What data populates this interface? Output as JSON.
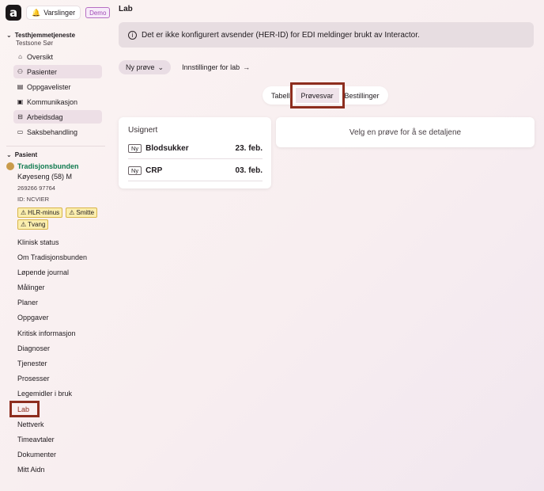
{
  "app": {
    "logo": "a",
    "notifications_label": "Varslinger",
    "demo_badge": "Demo"
  },
  "unit": {
    "name": "Testhjemmetjeneste",
    "zone": "Testsone Sør"
  },
  "nav_main": [
    {
      "label": "Oversikt",
      "icon": "home-icon"
    },
    {
      "label": "Pasienter",
      "icon": "people-icon",
      "active": true
    },
    {
      "label": "Oppgavelister",
      "icon": "clipboard-icon"
    },
    {
      "label": "Kommunikasjon",
      "icon": "message-icon"
    },
    {
      "label": "Arbeidsdag",
      "icon": "briefcase-icon",
      "active": true
    },
    {
      "label": "Saksbehandling",
      "icon": "folder-icon"
    }
  ],
  "patient_section": {
    "heading": "Pasient"
  },
  "patient": {
    "name": "Tradisjonsbunden",
    "bed": "Køyeseng (58) M",
    "number": "269266 97764",
    "id": "ID: NCVIER",
    "flags": [
      "HLR-minus",
      "Smitte",
      "Tvang"
    ]
  },
  "nav_patient": [
    "Klinisk status",
    "Om Tradisjonsbunden",
    "Løpende journal",
    "Målinger",
    "Planer",
    "Oppgaver",
    "Kritisk informasjon",
    "Diagnoser",
    "Tjenester",
    "Prosesser",
    "Legemidler i bruk",
    "Lab",
    "Nettverk",
    "Timeavtaler",
    "Dokumenter",
    "Mitt Aidn"
  ],
  "main": {
    "title": "Lab",
    "warning": "Det er ikke konfigurert avsender (HER-ID) for EDI meldinger brukt av Interactor.",
    "new_test_button": "Ny prøve",
    "settings_link": "Innstillinger for lab",
    "tabs": [
      "Tabell",
      "Prøvesvar",
      "Bestillinger"
    ],
    "active_tab": "Prøvesvar",
    "list_heading": "Usignert",
    "tests": [
      {
        "badge": "Ny",
        "name": "Blodsukker",
        "date": "23. feb."
      },
      {
        "badge": "Ny",
        "name": "CRP",
        "date": "03. feb."
      }
    ],
    "detail_placeholder": "Velg en prøve for å se detaljene"
  }
}
